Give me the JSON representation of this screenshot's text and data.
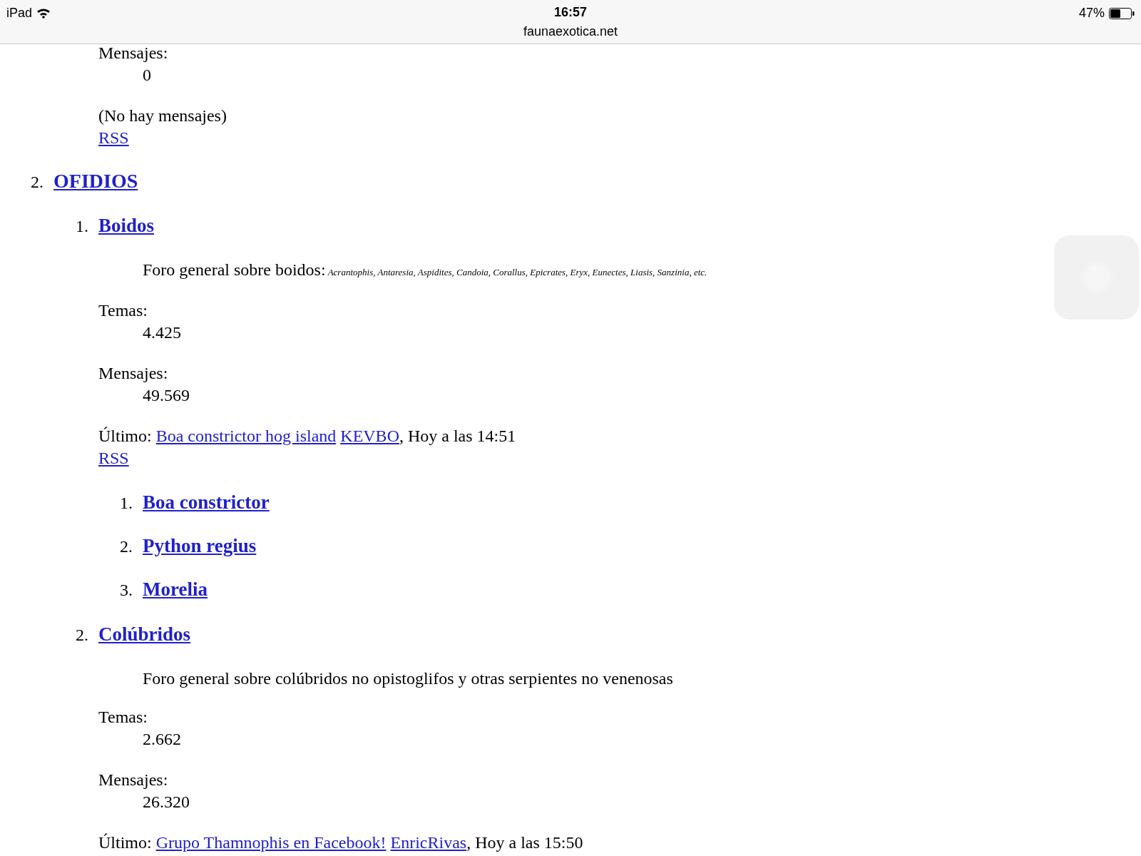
{
  "status_bar": {
    "device": "iPad",
    "time": "16:57",
    "battery": "47%",
    "url": "faunaexotica.net"
  },
  "top_fragment": {
    "stats": [
      {
        "label": "Mensajes:",
        "value": "0"
      }
    ],
    "last_post": "(No hay mensajes)",
    "rss": "RSS"
  },
  "categories": [
    {
      "number": "2.",
      "title": "OFIDIOS",
      "forums": [
        {
          "number": "1.",
          "title": "Boidos",
          "description": "Foro general sobre boidos:",
          "description_note": "Acrantophis, Antaresia, Aspidites, Candoia, Corallus, Epicrates, Eryx, Eunectes, Liasis, Sanzinia, etc.",
          "stats": [
            {
              "label": "Temas:",
              "value": "4.425"
            },
            {
              "label": "Mensajes:",
              "value": "49.569"
            }
          ],
          "last": {
            "label": "Último:",
            "topic": "Boa constrictor hog island",
            "author": "KEVBO",
            "time": ", Hoy a las 14:51"
          },
          "rss": "RSS",
          "subforums": [
            {
              "number": "1.",
              "title": "Boa constrictor"
            },
            {
              "number": "2.",
              "title": "Python regius"
            },
            {
              "number": "3.",
              "title": "Morelia"
            }
          ]
        },
        {
          "number": "2.",
          "title": "Colúbridos",
          "description": "Foro general sobre colúbridos no opistoglifos y otras serpientes no venenosas",
          "stats": [
            {
              "label": "Temas:",
              "value": "2.662"
            },
            {
              "label": "Mensajes:",
              "value": "26.320"
            }
          ],
          "last": {
            "label": "Último:",
            "topic": "Grupo Thamnophis en Facebook!",
            "author": "EnricRivas",
            "time": ", Hoy a las 15:50"
          }
        }
      ]
    }
  ]
}
